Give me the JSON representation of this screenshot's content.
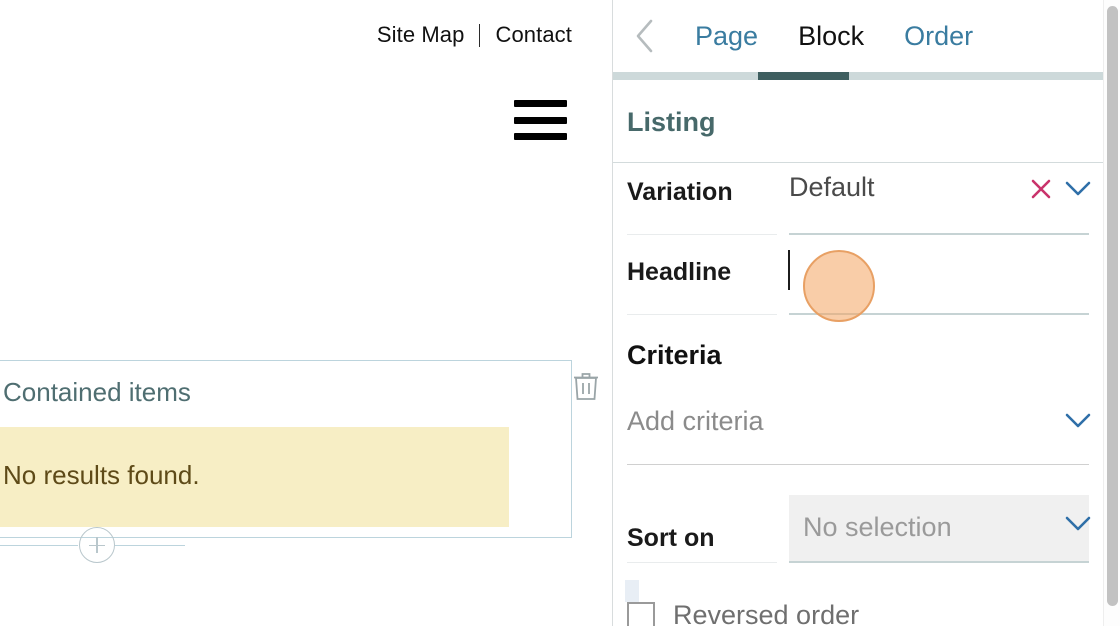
{
  "preview": {
    "util_nav": {
      "site_map": "Site Map",
      "contact": "Contact"
    },
    "menu_icon": "hamburger-menu-icon",
    "contained_items": {
      "title": "Contained items",
      "notice": "No results found.",
      "delete_icon": "trash-icon",
      "add_icon": "plus-circle-icon"
    }
  },
  "panel": {
    "back_icon": "chevron-left-icon",
    "tabs": [
      {
        "label": "Page",
        "active": false
      },
      {
        "label": "Block",
        "active": true
      },
      {
        "label": "Order",
        "active": false
      }
    ],
    "section_title": "Listing",
    "variation": {
      "label": "Variation",
      "value": "Default",
      "clear_icon": "close-x-icon",
      "dropdown_icon": "chevron-down-icon"
    },
    "headline": {
      "label": "Headline",
      "value": ""
    },
    "criteria": {
      "heading": "Criteria",
      "add_placeholder": "Add criteria",
      "dropdown_icon": "chevron-down-icon"
    },
    "sort_on": {
      "label": "Sort on",
      "value": "No selection",
      "dropdown_icon": "chevron-down-icon"
    },
    "reversed_order": {
      "label": "Reversed order",
      "checked": false
    }
  },
  "colors": {
    "tab_link": "#3a7ca0",
    "tab_active_underline": "#3f5f60",
    "tab_underline_track": "#cdd9da",
    "section_title": "#47696a",
    "notice_bg": "#f7eec5",
    "notice_text": "#5e4a18",
    "clear_x": "#c9336b",
    "chevron": "#2f6fa8",
    "click_halo": "#e8a064",
    "box_border": "#bcd4dd"
  }
}
